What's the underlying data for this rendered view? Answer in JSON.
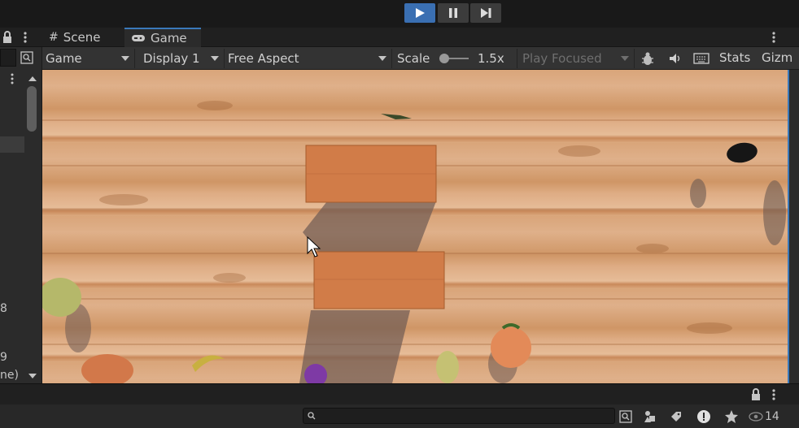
{
  "playbar": {
    "play": "play",
    "pause": "pause",
    "step": "step"
  },
  "tabs": [
    {
      "label": "Scene",
      "icon": "hash-icon",
      "active": false
    },
    {
      "label": "Game",
      "icon": "gamepad-icon",
      "active": true
    }
  ],
  "toolbar": {
    "mode": "Game",
    "display": "Display 1",
    "aspect": "Free Aspect",
    "scale_label": "Scale",
    "scale_value": "1.5x",
    "play_mode": "Play Focused",
    "stats": "Stats",
    "gizmos": "Gizm"
  },
  "left_panel": {
    "row1": "8",
    "row2": "9",
    "row3": "ne)"
  },
  "bottom": {
    "search_placeholder": "",
    "visibility_count": "14"
  },
  "colors": {
    "accent": "#3a79bb",
    "panel": "#2b2b2b",
    "background": "#191919"
  }
}
